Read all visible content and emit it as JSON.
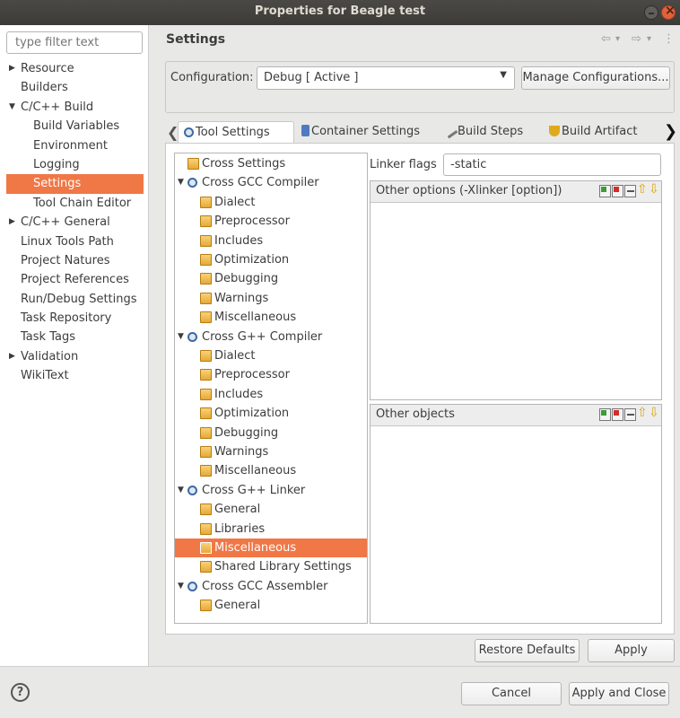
{
  "window": {
    "title": "Properties for Beagle test"
  },
  "filter": {
    "placeholder": "type filter text"
  },
  "nav": {
    "items": [
      {
        "label": "Resource",
        "indent": 0,
        "arrow": "▶"
      },
      {
        "label": "Builders",
        "indent": 0,
        "arrow": ""
      },
      {
        "label": "C/C++ Build",
        "indent": 0,
        "arrow": "▼"
      },
      {
        "label": "Build Variables",
        "indent": 1,
        "arrow": ""
      },
      {
        "label": "Environment",
        "indent": 1,
        "arrow": ""
      },
      {
        "label": "Logging",
        "indent": 1,
        "arrow": ""
      },
      {
        "label": "Settings",
        "indent": 1,
        "arrow": "",
        "selected": true
      },
      {
        "label": "Tool Chain Editor",
        "indent": 1,
        "arrow": ""
      },
      {
        "label": "C/C++ General",
        "indent": 0,
        "arrow": "▶"
      },
      {
        "label": "Linux Tools Path",
        "indent": 0,
        "arrow": ""
      },
      {
        "label": "Project Natures",
        "indent": 0,
        "arrow": ""
      },
      {
        "label": "Project References",
        "indent": 0,
        "arrow": ""
      },
      {
        "label": "Run/Debug Settings",
        "indent": 0,
        "arrow": ""
      },
      {
        "label": "Task Repository",
        "indent": 0,
        "arrow": ""
      },
      {
        "label": "Task Tags",
        "indent": 0,
        "arrow": ""
      },
      {
        "label": "Validation",
        "indent": 0,
        "arrow": "▶"
      },
      {
        "label": "WikiText",
        "indent": 0,
        "arrow": ""
      }
    ]
  },
  "header": {
    "title": "Settings",
    "icons": {
      "back": "⇦",
      "back_menu": "▾",
      "forward": "⇨",
      "forward_menu": "▾",
      "more": "⋮"
    }
  },
  "config": {
    "label": "Configuration:",
    "selected": "Debug  [ Active ]",
    "manage_label": "Manage Configurations..."
  },
  "tabs": {
    "items": [
      "Tool Settings",
      "Container Settings",
      "Build Steps",
      "Build Artifact"
    ],
    "left_arrow": "❮",
    "right_arrow": "❯"
  },
  "tree": {
    "rows": [
      {
        "label": "Cross Settings",
        "level": 0,
        "arrow": "",
        "icon": "folder"
      },
      {
        "label": "Cross GCC Compiler",
        "level": 0,
        "arrow": "▼",
        "icon": "gear"
      },
      {
        "label": "Dialect",
        "level": 1,
        "arrow": "",
        "icon": "folder"
      },
      {
        "label": "Preprocessor",
        "level": 1,
        "arrow": "",
        "icon": "folder"
      },
      {
        "label": "Includes",
        "level": 1,
        "arrow": "",
        "icon": "folder"
      },
      {
        "label": "Optimization",
        "level": 1,
        "arrow": "",
        "icon": "folder"
      },
      {
        "label": "Debugging",
        "level": 1,
        "arrow": "",
        "icon": "folder"
      },
      {
        "label": "Warnings",
        "level": 1,
        "arrow": "",
        "icon": "folder"
      },
      {
        "label": "Miscellaneous",
        "level": 1,
        "arrow": "",
        "icon": "folder"
      },
      {
        "label": "Cross G++ Compiler",
        "level": 0,
        "arrow": "▼",
        "icon": "gear"
      },
      {
        "label": "Dialect",
        "level": 1,
        "arrow": "",
        "icon": "folder"
      },
      {
        "label": "Preprocessor",
        "level": 1,
        "arrow": "",
        "icon": "folder"
      },
      {
        "label": "Includes",
        "level": 1,
        "arrow": "",
        "icon": "folder"
      },
      {
        "label": "Optimization",
        "level": 1,
        "arrow": "",
        "icon": "folder"
      },
      {
        "label": "Debugging",
        "level": 1,
        "arrow": "",
        "icon": "folder"
      },
      {
        "label": "Warnings",
        "level": 1,
        "arrow": "",
        "icon": "folder"
      },
      {
        "label": "Miscellaneous",
        "level": 1,
        "arrow": "",
        "icon": "folder"
      },
      {
        "label": "Cross G++ Linker",
        "level": 0,
        "arrow": "▼",
        "icon": "gear"
      },
      {
        "label": "General",
        "level": 1,
        "arrow": "",
        "icon": "folder"
      },
      {
        "label": "Libraries",
        "level": 1,
        "arrow": "",
        "icon": "folder"
      },
      {
        "label": "Miscellaneous",
        "level": 1,
        "arrow": "",
        "icon": "folder",
        "selected": true
      },
      {
        "label": "Shared Library Settings",
        "level": 1,
        "arrow": "",
        "icon": "folder"
      },
      {
        "label": "Cross GCC Assembler",
        "level": 0,
        "arrow": "▼",
        "icon": "gear"
      },
      {
        "label": "General",
        "level": 1,
        "arrow": "",
        "icon": "folder"
      }
    ]
  },
  "linker": {
    "flags_label": "Linker flags",
    "flags_value": "-static",
    "other_options_label": "Other options (-Xlinker [option])",
    "other_objects_label": "Other objects"
  },
  "buttons": {
    "restore_defaults": "Restore Defaults",
    "apply": "Apply",
    "cancel": "Cancel",
    "apply_and_close": "Apply and Close",
    "help": "?"
  },
  "colors": {
    "selection": "#f07746",
    "close_button": "#e0623a"
  }
}
